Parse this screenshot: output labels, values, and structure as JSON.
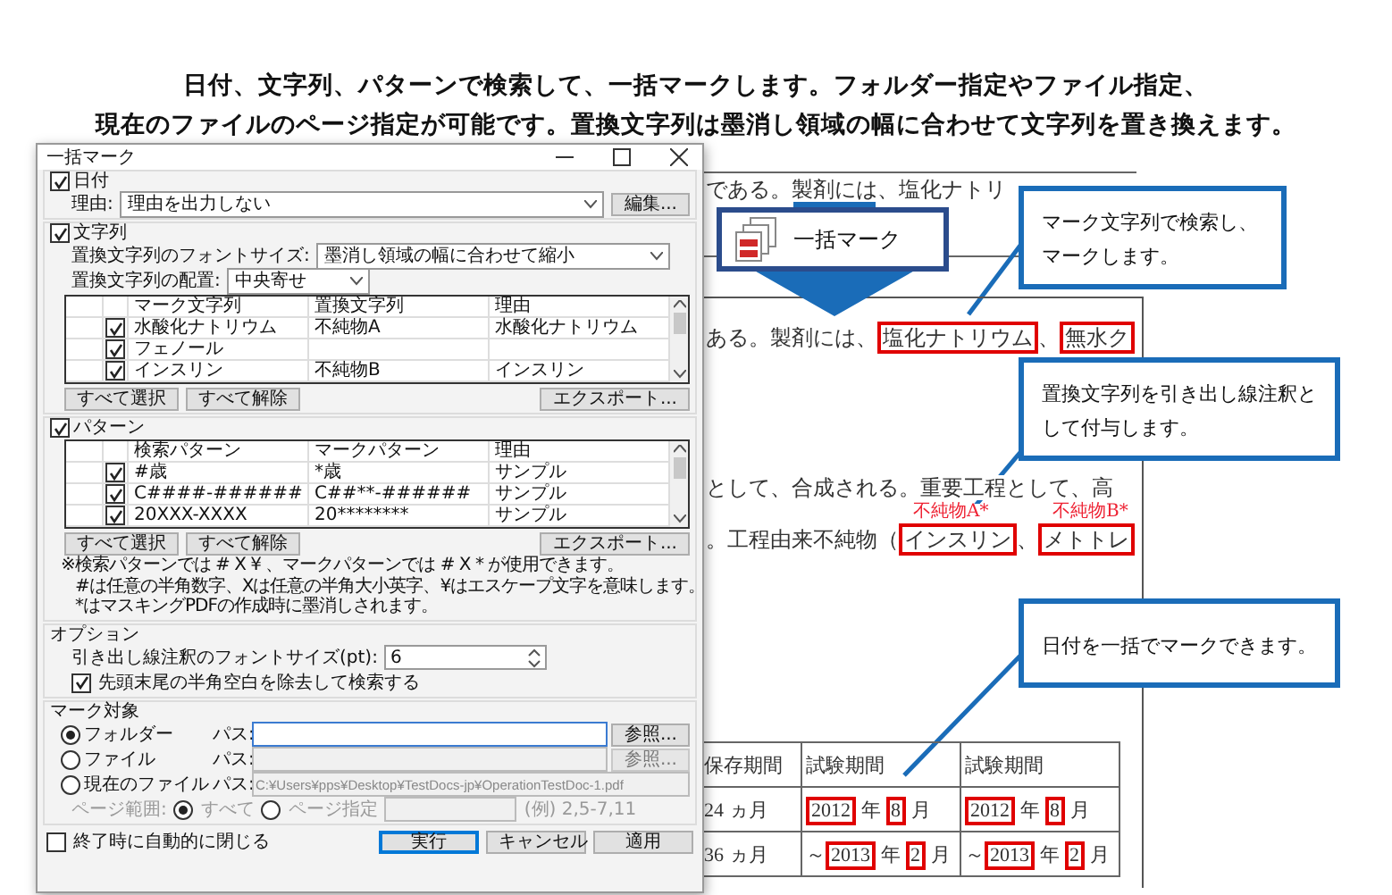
{
  "heading": {
    "lines": [
      "日付、文字列、パターンで検索して、一括マークします。フォルダー指定やファイル指定、",
      "現在のファイルのページ指定が可能です。置換文字列は墨消し領域の幅に合わせて文字列を置き換えます。"
    ]
  },
  "dialog": {
    "title": "一括マーク",
    "date": {
      "label": "日付",
      "checked": true,
      "reason_label": "理由:",
      "reason_value": "理由を出力しない",
      "edit_button": "編集..."
    },
    "strings": {
      "label": "文字列",
      "checked": true,
      "font_size_label": "置換文字列のフォントサイズ:",
      "font_size_value": "墨消し領域の幅に合わせて縮小",
      "align_label": "置換文字列の配置:",
      "align_value": "中央寄せ",
      "columns": [
        "マーク文字列",
        "置換文字列",
        "理由"
      ],
      "rows": [
        {
          "checked": true,
          "cells": [
            "水酸化ナトリウム",
            "不純物A",
            "水酸化ナトリウム"
          ]
        },
        {
          "checked": true,
          "cells": [
            "フェノール",
            "",
            ""
          ]
        },
        {
          "checked": true,
          "cells": [
            "インスリン",
            "不純物B",
            "インスリン"
          ]
        }
      ],
      "buttons": [
        "すべて選択",
        "すべて解除"
      ],
      "export_button": "エクスポート..."
    },
    "patterns": {
      "label": "パターン",
      "checked": true,
      "columns": [
        "検索パターン",
        "マークパターン",
        "理由"
      ],
      "rows": [
        {
          "checked": true,
          "cells": [
            "#歳",
            "*歳",
            "サンプル"
          ]
        },
        {
          "checked": true,
          "cells": [
            "C####-######",
            "C##**-######",
            "サンプル"
          ]
        },
        {
          "checked": true,
          "cells": [
            "20XXX-XXXX",
            "20********",
            "サンプル"
          ]
        }
      ],
      "buttons": [
        "すべて選択",
        "すべて解除"
      ],
      "export_button": "エクスポート...",
      "notes": [
        "※検索パターンでは # X ¥ 、マークパターンでは # X * が使用できます。",
        "#は任意の半角数字、Xは任意の半角大小英字、¥はエスケープ文字を意味します。",
        "*はマスキングPDFの作成時に墨消しされます。"
      ]
    },
    "options": {
      "label": "オプション",
      "font_size_label": "引き出し線注釈のフォントサイズ(pt):",
      "font_size_value": "6",
      "trim_label": "先頭末尾の半角空白を除去して検索する",
      "trim_checked": true
    },
    "target": {
      "label": "マーク対象",
      "items": [
        {
          "label": "フォルダー",
          "selected": true,
          "path_label": "パス:",
          "disabled": false,
          "browse_button": "参照..."
        },
        {
          "label": "ファイル",
          "selected": false,
          "path_label": "パス:",
          "disabled": true,
          "browse_button": "参照..."
        },
        {
          "label": "現在のファイル",
          "selected": false,
          "path_label": "パス:",
          "path": "C:¥Users¥pps¥Desktop¥TestDocs-jp¥OperationTestDoc-1.pdf",
          "disabled": true
        }
      ],
      "page_range": {
        "label": "ページ範囲:",
        "disabled": true,
        "options": [
          {
            "label": "すべて",
            "selected": true
          },
          {
            "label": "ページ指定",
            "selected": false
          }
        ],
        "example": "(例) 2,5-7,11"
      }
    },
    "footer": {
      "close_label": "終了時に自動的に閉じる",
      "close_checked": false,
      "buttons": [
        {
          "label": "実行",
          "default": true
        },
        {
          "label": "キャンセル",
          "default": false
        },
        {
          "label": "適用",
          "default": false
        }
      ]
    }
  },
  "mark_button": {
    "label": "一括マーク"
  },
  "callouts": [
    {
      "text": "マーク文字列で検索し、マークします。"
    },
    {
      "text": "置換文字列を引き出し線注釈として付与します。"
    },
    {
      "text": "日付を一括でマークできます。"
    }
  ],
  "document": {
    "page1_text": "である。製剤には、塩化ナトリ",
    "lines": [
      [
        {
          "text": "ある。製剤には、",
          "marked": false
        },
        {
          "text": "塩化ナトリウム",
          "marked": true
        },
        {
          "text": "、",
          "marked": false
        },
        {
          "text": "無水ク",
          "marked": true
        }
      ],
      [
        {
          "text": "として、合成される。重要工程として、高",
          "marked": false
        }
      ],
      [
        {
          "text": "。工程由来不純物（",
          "marked": false
        },
        {
          "text": "インスリン",
          "marked": true,
          "note": "不純物A*"
        },
        {
          "text": "、",
          "marked": false
        },
        {
          "text": "メトトレ",
          "marked": true,
          "note": "不純物B*"
        }
      ]
    ],
    "table": {
      "columns": [
        "保存期間",
        "試験期間",
        "試験期間"
      ],
      "rows": [
        [
          [
            {
              "text": "24 ヵ月",
              "marked": false
            }
          ],
          [
            {
              "text": "2012",
              "marked": true
            },
            {
              "text": " 年 ",
              "marked": false
            },
            {
              "text": "8",
              "marked": true
            },
            {
              "text": " 月",
              "marked": false
            }
          ],
          [
            {
              "text": "2012",
              "marked": true
            },
            {
              "text": " 年 ",
              "marked": false
            },
            {
              "text": "8",
              "marked": true
            },
            {
              "text": " 月",
              "marked": false
            }
          ]
        ],
        [
          [
            {
              "text": "36 ヵ月",
              "marked": false
            }
          ],
          [
            {
              "text": "～",
              "marked": false
            },
            {
              "text": "2013",
              "marked": true
            },
            {
              "text": " 年 ",
              "marked": false
            },
            {
              "text": "2",
              "marked": true
            },
            {
              "text": " 月",
              "marked": false
            }
          ],
          [
            {
              "text": "～",
              "marked": false
            },
            {
              "text": "2013",
              "marked": true
            },
            {
              "text": " 年 ",
              "marked": false
            },
            {
              "text": "2",
              "marked": true
            },
            {
              "text": " 月",
              "marked": false
            }
          ]
        ]
      ]
    }
  }
}
